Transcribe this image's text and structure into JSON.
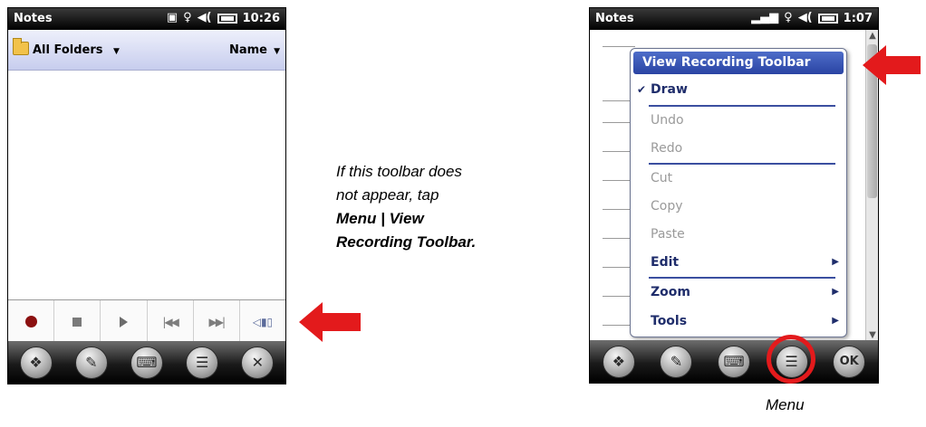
{
  "left_phone": {
    "status": {
      "title": "Notes",
      "time": "10:26"
    },
    "folder_bar": {
      "folder": "All Folders",
      "sort": "Name"
    },
    "recording_toolbar": [
      "record",
      "stop",
      "play",
      "previous",
      "next",
      "volume"
    ],
    "softkeys": [
      "windows-start",
      "new-note",
      "keyboard",
      "menu",
      "close"
    ]
  },
  "instruction": {
    "line1": "If this toolbar does",
    "line2": "not appear, tap",
    "line3": "Menu | View",
    "line4": "Recording Toolbar."
  },
  "right_phone": {
    "status": {
      "title": "Notes",
      "time": "1:07"
    },
    "menu": {
      "items": [
        {
          "label": "View Recording Toolbar",
          "state": "highlighted"
        },
        {
          "label": "Draw",
          "state": "checked"
        },
        {
          "label": "Undo",
          "state": "disabled"
        },
        {
          "label": "Redo",
          "state": "disabled"
        },
        {
          "label": "Cut",
          "state": "disabled"
        },
        {
          "label": "Copy",
          "state": "disabled"
        },
        {
          "label": "Paste",
          "state": "disabled"
        },
        {
          "label": "Edit",
          "state": "submenu"
        },
        {
          "label": "Zoom",
          "state": "submenu"
        },
        {
          "label": "Tools",
          "state": "submenu"
        }
      ]
    },
    "softkeys": [
      "windows-start",
      "new-note",
      "keyboard",
      "menu",
      "ok"
    ],
    "ok_label": "OK"
  },
  "caption": "Menu",
  "colors": {
    "arrow": "#e31a1c",
    "menu_highlight": "#2f4aa8",
    "header_gradient": "#c7cdee"
  }
}
